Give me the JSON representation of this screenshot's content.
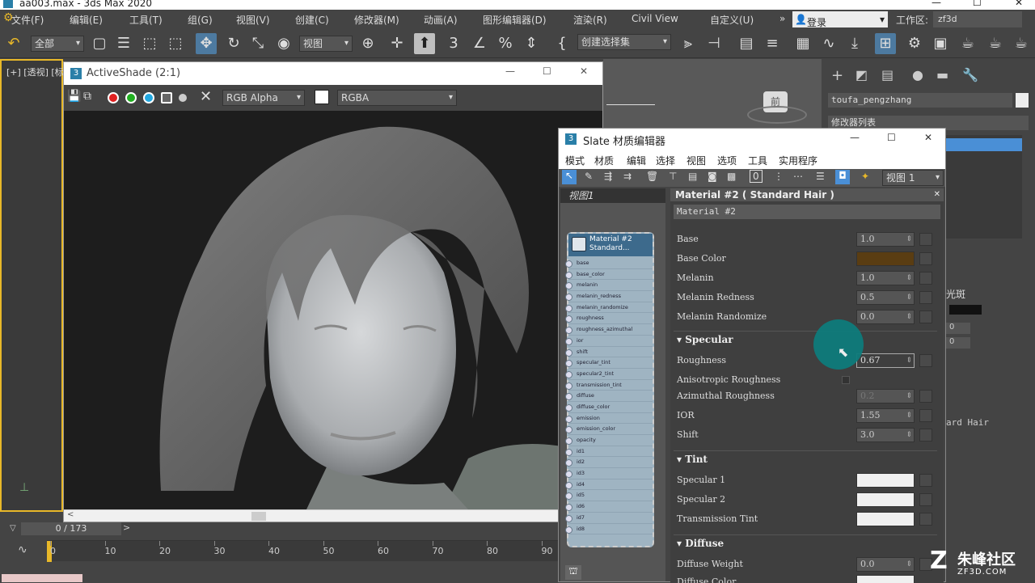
{
  "titlebar": {
    "title": "aa003.max - 3ds Max 2020",
    "min": "—",
    "max": "☐",
    "close": "✕"
  },
  "menu": {
    "items": [
      "文件(F)",
      "编辑(E)",
      "工具(T)",
      "组(G)",
      "视图(V)",
      "创建(C)",
      "修改器(M)",
      "动画(A)",
      "图形编辑器(D)",
      "渲染(R)",
      "Civil View",
      "自定义(U)"
    ],
    "more": "»",
    "login": "登录",
    "workspace_label": "工作区:",
    "workspace_value": "zf3d"
  },
  "toolbar": {
    "selection_filter": "全部",
    "coord_system": "视图",
    "named_selection": "创建选择集",
    "viewport_label": "视图"
  },
  "viewport": {
    "label": "[+] [透视] [标"
  },
  "activeshade": {
    "title": "ActiveShade (2:1)",
    "channel": "RGB Alpha",
    "display": "RGBA"
  },
  "command_panel": {
    "object_name": "toufa_pengzhang",
    "modifier_list": "修改器列表",
    "partial_text_1": "光斑",
    "partial_text_2": "ard Hair",
    "spin_a": "0",
    "spin_b": "0"
  },
  "slate": {
    "title": "Slate 材质编辑器",
    "menu": [
      "模式",
      "材质",
      "编辑",
      "选择",
      "视图",
      "选项",
      "工具",
      "实用程序"
    ],
    "view_dropdown": "视图 1",
    "view_tab": "视图1",
    "node": {
      "title": "Material #2",
      "subtitle": "Standard...",
      "slots": [
        "base",
        "base_color",
        "melanin",
        "melanin_redness",
        "melanin_randomize",
        "roughness",
        "roughness_azimuthal",
        "ior",
        "shift",
        "specular_tint",
        "specular2_tint",
        "transmission_tint",
        "diffuse",
        "diffuse_color",
        "emission",
        "emission_color",
        "opacity",
        "id1",
        "id2",
        "id3",
        "id4",
        "id5",
        "id6",
        "id7",
        "id8"
      ]
    },
    "panel_header": "Material #2 ( Standard Hair )",
    "material_name": "Material #2",
    "params": {
      "base_label": "Base",
      "base_value": "1.0",
      "base_color_label": "Base Color",
      "melanin_label": "Melanin",
      "melanin_value": "1.0",
      "melanin_redness_label": "Melanin Redness",
      "melanin_redness_value": "0.5",
      "melanin_randomize_label": "Melanin Randomize",
      "melanin_randomize_value": "0.0",
      "specular_section": "Specular",
      "roughness_label": "Roughness",
      "roughness_value": "0.67",
      "aniso_label": "Anisotropic Roughness",
      "azimuthal_label": "Azimuthal Roughness",
      "azimuthal_value": "0.2",
      "ior_label": "IOR",
      "ior_value": "1.55",
      "shift_label": "Shift",
      "shift_value": "3.0",
      "tint_section": "Tint",
      "spec1_label": "Specular 1",
      "spec2_label": "Specular 2",
      "trans_label": "Transmission Tint",
      "diffuse_section": "Diffuse",
      "diffuse_weight_label": "Diffuse Weight",
      "diffuse_weight_value": "0.0",
      "diffuse_color_label": "Diffuse Color"
    },
    "colors": {
      "base_color": "#5a3d12",
      "tint_white": "#f0f0f0"
    }
  },
  "timeline": {
    "frame": "0 / 173",
    "ticks": [
      "0",
      "10",
      "20",
      "30",
      "40",
      "50",
      "60",
      "70",
      "80",
      "90"
    ]
  },
  "watermark": {
    "brand": "朱峰社区",
    "url": "ZF3D.COM"
  }
}
